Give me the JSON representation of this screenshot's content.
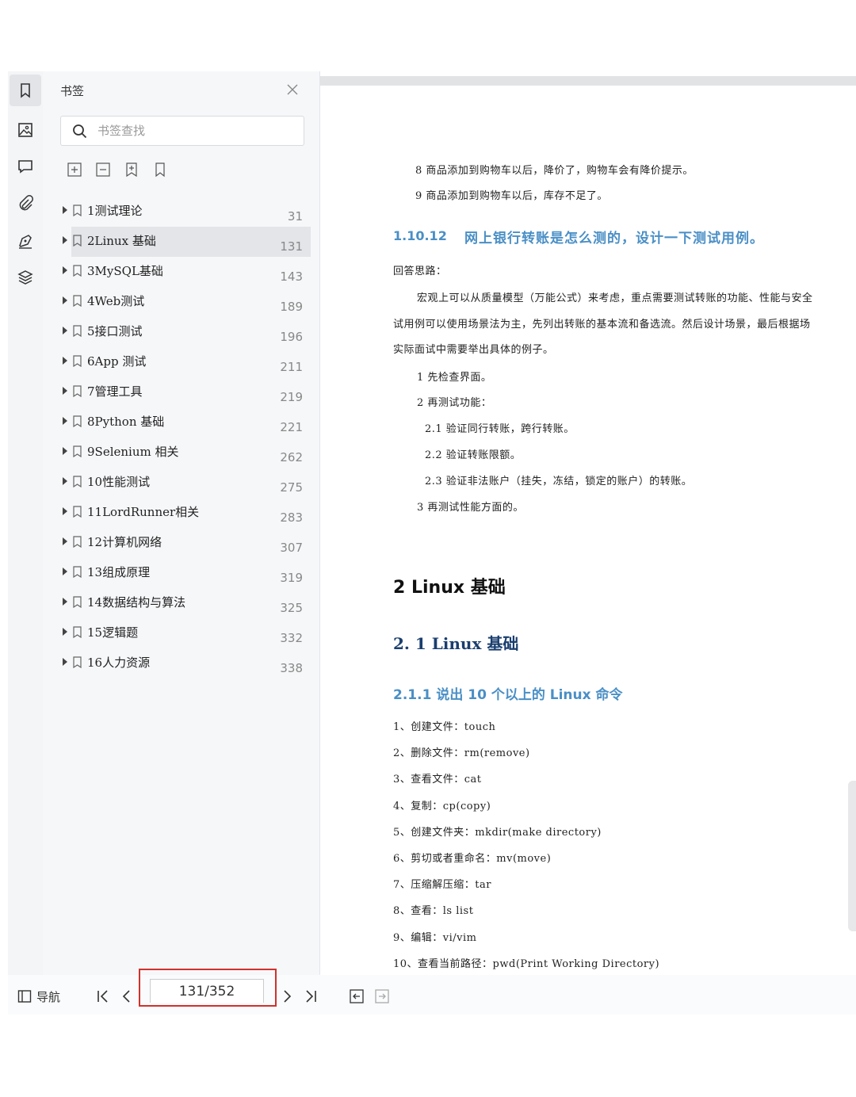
{
  "panel": {
    "title": "书签",
    "search_placeholder": "书签查找"
  },
  "bookmarks": [
    {
      "label": "1测试理论",
      "page": "31"
    },
    {
      "label": "2Linux 基础",
      "page": "131",
      "selected": true
    },
    {
      "label": "3MySQL基础",
      "page": "143"
    },
    {
      "label": "4Web测试",
      "page": "189"
    },
    {
      "label": "5接口测试",
      "page": "196"
    },
    {
      "label": "6App 测试",
      "page": "211"
    },
    {
      "label": "7管理工具",
      "page": "219"
    },
    {
      "label": "8Python 基础",
      "page": "221"
    },
    {
      "label": "9Selenium 相关",
      "page": "262"
    },
    {
      "label": "10性能测试",
      "page": "275"
    },
    {
      "label": "11LordRunner相关",
      "page": "283"
    },
    {
      "label": "12计算机网络",
      "page": "307"
    },
    {
      "label": "13组成原理",
      "page": "319"
    },
    {
      "label": "14数据结构与算法",
      "page": "325"
    },
    {
      "label": "15逻辑题",
      "page": "332"
    },
    {
      "label": "16人力资源",
      "page": "338"
    }
  ],
  "bottom": {
    "nav_label": "导航",
    "page_indicator": "131/352"
  },
  "doc": {
    "line_8": "8  商品添加到购物车以后，降价了，购物车会有降价提示。",
    "line_9": "9  商品添加到购物车以后，库存不足了。",
    "h_1_10_12_num": "1.10.12",
    "h_1_10_12_text": "网上银行转账是怎么测的，设计一下测试用例。",
    "answer_label": "回答思路：",
    "para_1": "宏观上可以从质量模型（万能公式）来考虑，重点需要测试转账的功能、性能与安全",
    "para_2": "试用例可以使用场景法为主，先列出转账的基本流和备选流。然后设计场景，最后根据场",
    "para_3": "实际面试中需要举出具体的例子。",
    "step_1": "1  先检查界面。",
    "step_2": "2  再测试功能：",
    "step_2_1": "2.1  验证同行转账，跨行转账。",
    "step_2_2": "2.2  验证转账限额。",
    "step_2_3": "2.3  验证非法账户（挂失，冻结，锁定的账户）的转账。",
    "step_3": "3  再测试性能方面的。",
    "chapter": "2   Linux  基础",
    "section": "2. 1  Linux 基础",
    "subsection": "2.1.1   说出 10 个以上的 Linux 命令",
    "commands": [
      "1、创建文件：touch",
      "2、删除文件：rm(remove)",
      "3、查看文件：cat",
      "4、复制：cp(copy)",
      "5、创建文件夹：mkdir(make directory)",
      "6、剪切或者重命名：mv(move)",
      "7、压缩解压缩：tar",
      "8、查看：ls   list",
      "9、编辑：vi/vim",
      "10、查看当前路径：pwd(Print Working Directory)"
    ]
  }
}
